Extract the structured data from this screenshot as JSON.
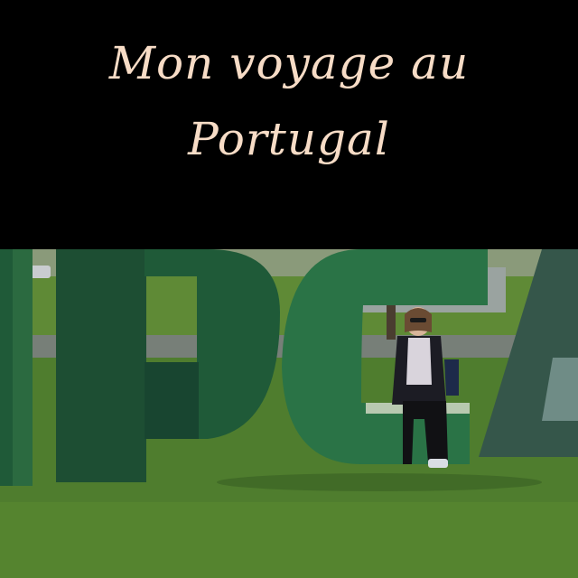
{
  "title": {
    "line1": "Mon voyage au",
    "line2": "Portugal"
  },
  "colors": {
    "background": "#000000",
    "title_text": "#f7dcc6",
    "grass": "#4f7d2e",
    "letters": "#1f5a38"
  }
}
